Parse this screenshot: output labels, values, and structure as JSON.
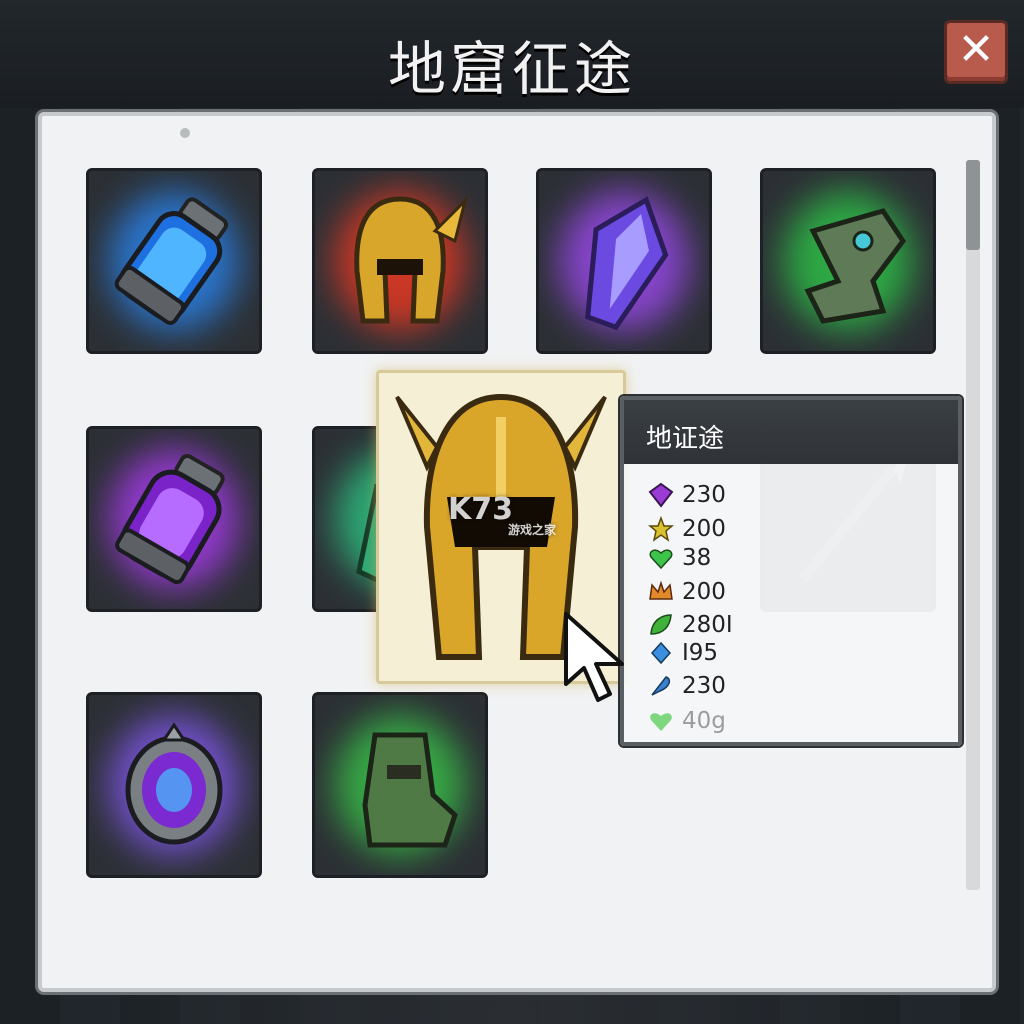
{
  "window": {
    "title": "地窟征途",
    "close_label": "✕"
  },
  "inventory": {
    "slots": [
      {
        "icon": "blue-potion-icon",
        "glow": "#2a8cff"
      },
      {
        "icon": "gold-helmet-icon",
        "glow": "#ff3a20"
      },
      {
        "icon": "purple-crystal-icon",
        "glow": "#a64cff"
      },
      {
        "icon": "green-gauntlet-icon",
        "glow": "#2ed14a"
      },
      {
        "icon": "purple-potion-icon",
        "glow": "#b43cff"
      },
      {
        "icon": "green-crystal-icon",
        "glow": "#2ed18a"
      },
      {
        "icon": "purple-amulet-icon",
        "glow": "#8a5cff"
      },
      {
        "icon": "green-boot-icon",
        "glow": "#3ad14a"
      }
    ],
    "dragged_item": {
      "icon": "gold-helmet-icon"
    }
  },
  "watermark": {
    "text": "K73",
    "sub": "游戏之家"
  },
  "tooltip": {
    "title": "地证途",
    "stats": [
      {
        "icon": "purple-gem-icon",
        "color": "#9b3bd6",
        "value": "230"
      },
      {
        "icon": "gold-star-icon",
        "color": "#d9c22e",
        "value": "200"
      },
      {
        "icon": "green-heart-icon",
        "color": "#3cc54a",
        "value": "38"
      },
      {
        "icon": "crown-icon",
        "color": "#e08a2a",
        "value": "200"
      },
      {
        "icon": "green-leaf-icon",
        "color": "#3fb23a",
        "value": "280I"
      },
      {
        "icon": "blue-diamond-icon",
        "color": "#3a8fe0",
        "value": "I95"
      },
      {
        "icon": "blue-feather-icon",
        "color": "#3a7fd0",
        "value": "230"
      },
      {
        "icon": "green-heart-icon",
        "color": "#7ed67e",
        "value": "40g"
      }
    ]
  }
}
